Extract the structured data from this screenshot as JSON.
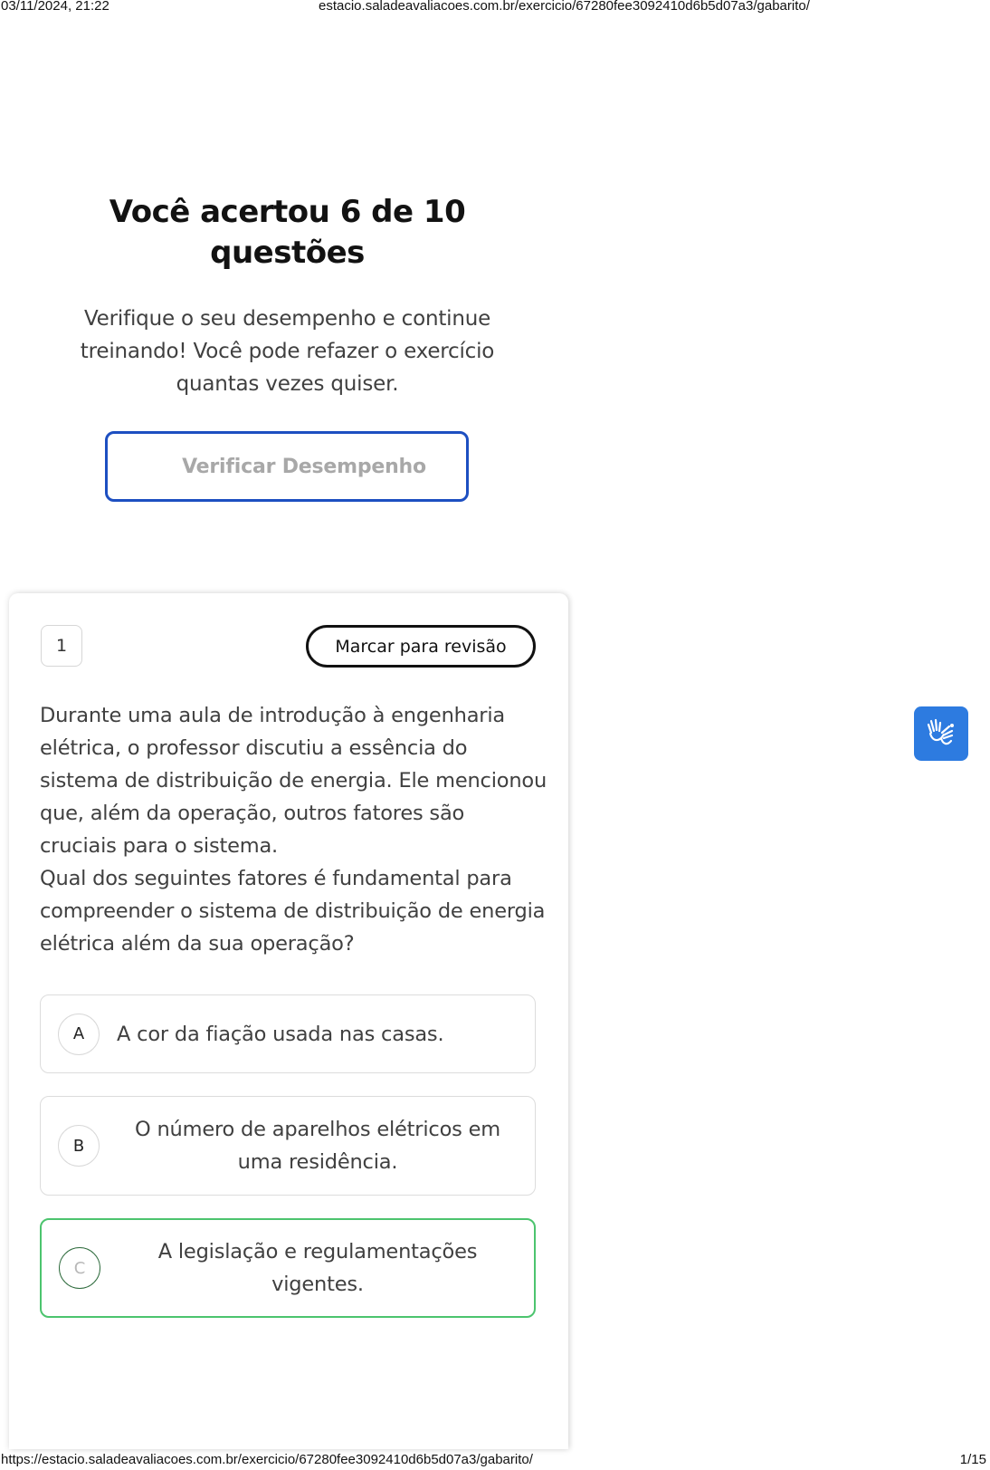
{
  "print_header": {
    "datetime": "03/11/2024, 21:22",
    "page_url": "estacio.saladeavaliacoes.com.br/exercicio/67280fee3092410d6b5d07a3/gabarito/"
  },
  "print_footer": {
    "full_url": "https://estacio.saladeavaliacoes.com.br/exercicio/67280fee3092410d6b5d07a3/gabarito/",
    "page_counter": "1/15"
  },
  "result": {
    "title": "Você acertou 6 de 10 questões",
    "subtitle": "Verifique o seu desempenho e continue treinando! Você pode refazer o exercício quantas vezes quiser.",
    "verify_button_label": "Verificar Desempenho"
  },
  "question": {
    "number": "1",
    "review_button_label": "Marcar para revisão",
    "text_paragraph_1": "Durante uma aula de introdução à engenharia elétrica, o professor discutiu a essência do sistema de distribuição de energia. Ele mencionou que, além da operação, outros fatores são cruciais para o sistema.",
    "text_paragraph_2": "Qual dos seguintes fatores é fundamental para compreender o sistema de distribuição de energia elétrica além da sua operação?",
    "options": [
      {
        "letter": "A",
        "text": "A cor da fiação usada nas casas.",
        "state": "neutral"
      },
      {
        "letter": "B",
        "text": "O número de aparelhos elétricos em uma residência.",
        "state": "neutral"
      },
      {
        "letter": "C",
        "text": "A legislação e regulamentações vigentes.",
        "state": "correct"
      }
    ]
  },
  "accessibility": {
    "icon": "sign-language-hands-icon",
    "color": "#2d7be0"
  },
  "colors": {
    "primary_border": "#1d4fc1",
    "correct_border": "#4cc46e",
    "muted_text": "#a8a8a8"
  }
}
